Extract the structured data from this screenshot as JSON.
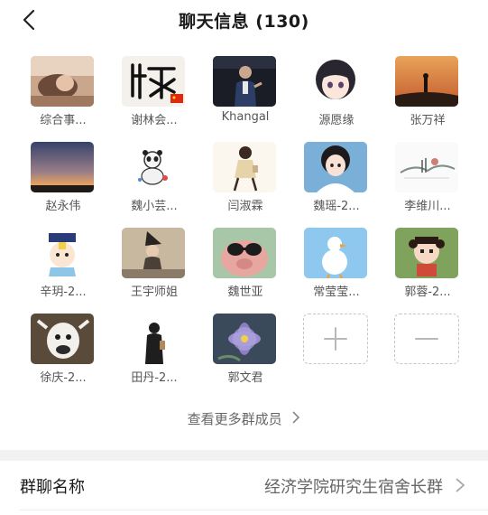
{
  "header": {
    "title": "聊天信息 (130)"
  },
  "members": [
    {
      "name": "综合事..."
    },
    {
      "name": "谢林会..."
    },
    {
      "name": "Khangal"
    },
    {
      "name": "源愿缘"
    },
    {
      "name": "张万祥"
    },
    {
      "name": "赵永伟"
    },
    {
      "name": "魏小芸..."
    },
    {
      "name": "闫淑霖"
    },
    {
      "name": "魏瑶-2..."
    },
    {
      "name": "李维川..."
    },
    {
      "name": "辛玥-2..."
    },
    {
      "name": "王宇师姐"
    },
    {
      "name": "魏世亚"
    },
    {
      "name": "常莹莹..."
    },
    {
      "name": "郭蓉-2..."
    },
    {
      "name": "徐庆-2..."
    },
    {
      "name": "田丹-2..."
    },
    {
      "name": "郭文君"
    }
  ],
  "more_members_label": "查看更多群成员",
  "group_name": {
    "label": "群聊名称",
    "value": "经济学院研究生宿舍长群"
  }
}
